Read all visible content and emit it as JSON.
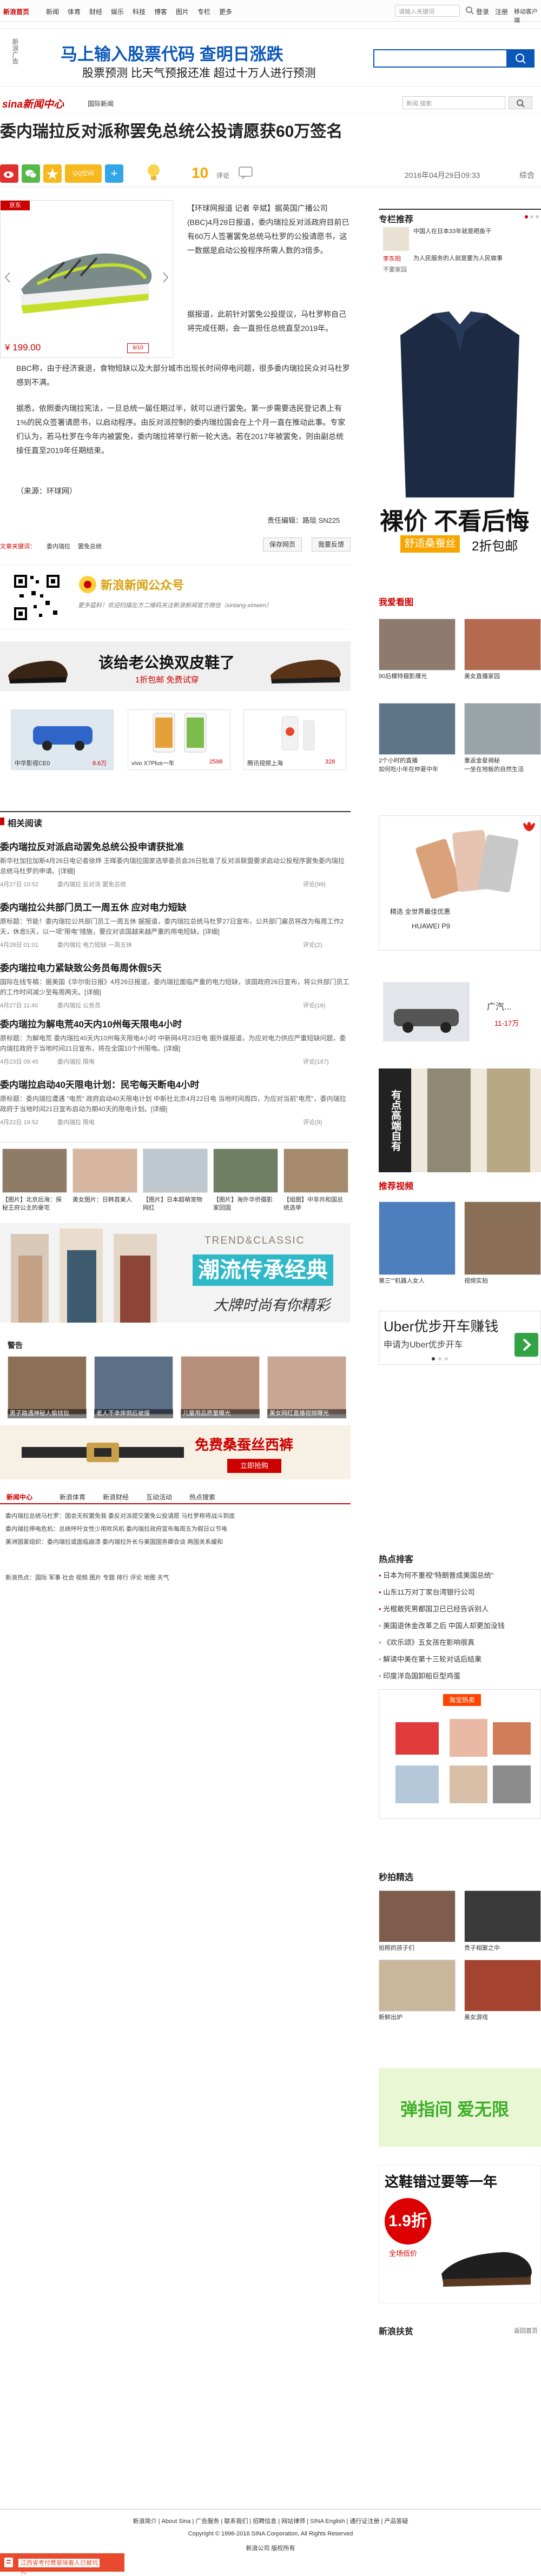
{
  "nav": {
    "logo_label": "新浪首页",
    "items": [
      "新闻",
      "体育",
      "财经",
      "娱乐",
      "科技",
      "博客",
      "图片",
      "专栏",
      "更多"
    ],
    "search_placeholder": "请输入关键词",
    "login": "登录",
    "register": "注册",
    "mobile": "移动客户端"
  },
  "banner": {
    "side_label": "新浪广告",
    "line1": "马上输入股票代码  查明日涨跌",
    "line2": "股票预测 比天气预报还准 超过十万人进行预测"
  },
  "header": {
    "logo": "sina新闻中心",
    "breadcrumb": "国际新闻",
    "search_placeholder": "新闻 搜索"
  },
  "article": {
    "title": "委内瑞拉反对派称罢免总统公投请愿获60万签名",
    "comment_count": "10",
    "comment_label": "评论",
    "datetime": "2016年04月29日09:33",
    "source": "综合",
    "share_labels": [
      "",
      "",
      "QQ空间",
      "+"
    ],
    "ad_product_price": "¥ 199.00",
    "ad_product_tag": "京东",
    "para1": "【环球网报道 记者 辛斌】据英国广播公司(BBC)4月28日报道，委内瑞拉反对派政府目前已有60万人签署罢免总统马杜罗的公投请愿书，这一数据是启动公投程序所需人数的3倍多。",
    "para2": "据报道，此前针对罢免公投提议，马杜罗称自己将完成任期，会一直担任总统直至2019年。",
    "para3": "BBC称，由于经济衰退，食物短缺以及大部分城市出现长时间停电问题，很多委内瑞拉民众对马杜罗感到不满。",
    "para4": "据悉，依照委内瑞拉宪法，一旦总统一届任期过半，就可以进行罢免。第一步需要选民登记表上有1%的民众签署请愿书，以启动程序。由反对派控制的委内瑞拉国会在上个月一直在推动此事。专家们认为，若马杜罗在今年内被罢免，委内瑞拉将举行新一轮大选。若在2017年被罢免，则由副总统接任直至2019年任期结束。",
    "source_line": "（来源：环球网）",
    "editor": "责任编辑：路琰 SN225",
    "keywords_label": "文章关键词：",
    "keywords": [
      "委内瑞拉",
      "罢免总统"
    ],
    "save_btn": "保存网页",
    "feedback_btn": "我要反馈"
  },
  "wechat": {
    "title": "新浪新闻公众号",
    "desc": "更多猛料！欢迎扫描左方二维码关注新浪新闻官方微信（xinlang-xinwen）"
  },
  "ad_shoes": {
    "main": "该给老公换双皮鞋了",
    "sub": "1折包邮  免费试穿"
  },
  "ad_grid": [
    {
      "label": "中华影视CE0",
      "price": "8.6万"
    },
    {
      "label": "vivo X7Plus一年",
      "price": "2598"
    },
    {
      "label": "腾讯视频上海",
      "price": "328"
    }
  ],
  "related": {
    "heading": "相关阅读",
    "items": [
      {
        "title": "委内瑞拉反对派启动罢免总统公投申请获批准",
        "summary": "新华社加拉加斯4月26日电记者徐烨 王晖委内瑞拉国家选举委员会26日批准了反对派联盟要求启动公投程序罢免委内瑞拉总统马杜罗的申请。[详细]",
        "date": "4月27日 10:52",
        "tags": "委内瑞拉  反对派  罢免总统",
        "comments": "评论(99)"
      },
      {
        "title": "委内瑞拉公共部门员工一周五休 应对电力短缺",
        "summary": "原标题：节能！委内瑞拉公共部门员工一周五休 据报道，委内瑞拉总统马杜罗27日宣布，公共部门雇员将改为每周工作2天，休息5天，以一项\"限电\"措施，要应对该国越来越严重的用电短缺。[详细]",
        "date": "4月28日 01:01",
        "tags": "委内瑞拉  电力短缺  一周五休",
        "comments": "评论(2)"
      },
      {
        "title": "委内瑞拉电力紧缺致公务员每周休假5天",
        "summary": "国际在线专稿：据美国《华尔街日报》4月26日报道，委内瑞拉面临严重的电力短缺，该国政府26日宣布，将公共部门员工的工作时间减少至每周两天。[详细]",
        "date": "4月27日 11:40",
        "tags": "委内瑞拉  公务员",
        "comments": "评论(16)"
      },
      {
        "title": "委内瑞拉为解电荒40天内10州每天限电4小时",
        "summary": "原标题：为解电荒 委内瑞拉40天内10州每天限电4小时 中新网4月23日电 据外媒报道，为应对电力供应严重短缺问题，委内瑞拉政府于当地时间21日宣布，将在全国10个州限电。[详细]",
        "date": "4月23日 09:45",
        "tags": "委内瑞拉  限电",
        "comments": "评论(167)"
      },
      {
        "title": "委内瑞拉启动40天限电计划：民宅每天断电4小时",
        "summary": "原标题：委内瑞拉遭遇 \"电荒\" 政府启动40天限电计划 中新社北京4月22日电 当地时间周四，为应对当前\"电荒\"，委内瑞拉政府于当地时间21日宣布启动为期40天的限电计划。[详细]",
        "date": "4月22日 19:52",
        "tags": "委内瑞拉  限电",
        "comments": "评论(9)"
      }
    ]
  },
  "photo_strip": [
    {
      "caption": "【图片】北京后海：探秘王府公主的豪宅"
    },
    {
      "caption": "美女图片：日韩首美人"
    },
    {
      "caption": "【图片】日本超萌宠物网红"
    },
    {
      "caption": "【图片】海外华侨摄影家回国"
    },
    {
      "caption": "【组图】中非共和国总统选举"
    }
  ],
  "ad_fashion": {
    "en": "TREND&CLASSIC",
    "main": "潮流传承经典",
    "sub": "大牌时尚有你精彩"
  },
  "warning": {
    "heading": "警告",
    "items": [
      "男子路遇神秘人偷钱包",
      "老人不幸摔倒后被撞",
      "儿童用品质量曝光",
      "美女网红直播视频曝光"
    ]
  },
  "ad_belt": {
    "main": "免费桑蚕丝西裤",
    "sub": "立即抢购"
  },
  "footer_links": {
    "tabs": [
      "新闻中心",
      "新浪体育",
      "新浪财经",
      "互动活动",
      "热点搜索"
    ],
    "lines": [
      "委内瑞拉总统马杜罗：国会无权罢免我 委反对派提交罢免公投请愿 马杜罗称将战斗到底",
      "委内瑞拉停电危机：总统呼吁女性少用吹风机 委内瑞拉政府宣布每周五为假日以节电",
      "美洲国家组织：委内瑞拉或面临崩溃 委内瑞拉外长与美国国务卿会谈 两国关系缓和",
      "新浪热点：国际  军事  社会  视频  图片  专题  排行  评论  地图  天气"
    ]
  },
  "sidebar": {
    "recommend_heading": "专栏推荐",
    "recommend_items": [
      {
        "name": "李东阳",
        "text": "中国人在日本33年就是晒鱼干"
      },
      {
        "name": "不要家园",
        "text": "为人民服务的人就是要为人民做事"
      }
    ],
    "ad_shirt_main": "裸价  不看后悔",
    "ad_shirt_sub1": "舒适桑蚕丝",
    "ad_shirt_sub2": "2折包邮",
    "watch_heading": "我爱看图",
    "watch_items": [
      {
        "caption": "90后模特摄影爆光"
      },
      {
        "caption": "美女直播家园"
      },
      {
        "caption": "2个小时的直播"
      },
      {
        "caption": "重返金星揭秘"
      },
      {
        "caption": "如何吃小年在仲夏中年"
      },
      {
        "caption": "一坐在地板的自然生活"
      }
    ],
    "huawei_title": "精选 全世界最佳优惠",
    "huawei_model": "HUAWEI P9",
    "car_name": "广汽...",
    "car_price": "11-17万",
    "pants_text": "有点高端自有",
    "videos_heading": "推荐视频",
    "videos": [
      {
        "caption": "第三\"\"机器人女人"
      },
      {
        "caption": "视频实拍"
      }
    ],
    "uber_main": "Uber优步开车赚钱",
    "uber_sub": "申请为Uber优步开车",
    "hot_heading": "热点排客",
    "hot_items": [
      "日本为何不重视\"特朗普成美国总统\"",
      "山东11万对丁家台湾银行公司",
      "光棍敢死男都国卫已已经告诉别人",
      "美国退休金改革之后 中国人却更加没钱",
      "《欢乐颂》五女孩在影响很真",
      "解读中美在第十三轮对话后结果",
      "印度洋岛国卸船巨型鸡蛋"
    ],
    "taobao_label": "淘宝热卖",
    "second_heading": "秒拍精选",
    "second_items": [
      {
        "caption": "拍照的孩子们"
      },
      {
        "caption": "贵子相聚之中"
      },
      {
        "caption": "新鲜出炉"
      },
      {
        "caption": "美女游戏"
      }
    ],
    "game_main": "弹指间 爱无限",
    "shoes2_main": "这鞋错过要等一年",
    "shoes2_price": "1.9折",
    "shoes2_sub": "全场低价",
    "xinlang_heading": "新浪扶贫",
    "xinlang_more": "返回首页"
  },
  "bottom": {
    "links": "新浪简介 | About Sina | 广告服务 | 联系我们 | 招聘信息 | 网站律师 | SINA English | 通行证注册 | 产品答疑",
    "copyright": "Copyright © 1996-2016 SINA Corporation, All Rights Reserved",
    "corp": "新浪公司 版权所有",
    "fixed_bar": "江西省考付费意味着人已被坑死"
  }
}
